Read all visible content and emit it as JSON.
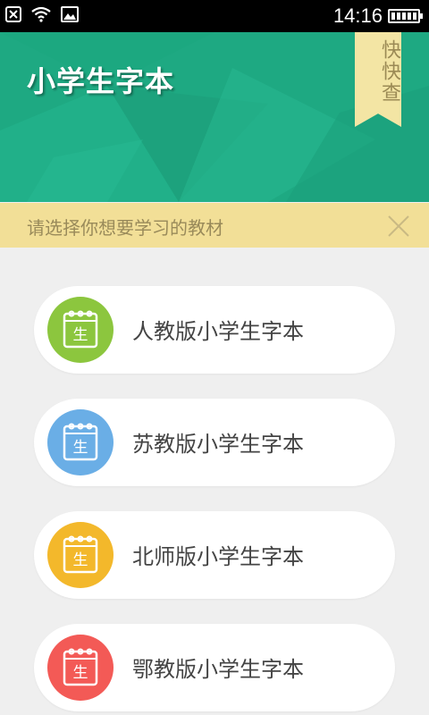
{
  "statusbar": {
    "time": "14:16",
    "icons": [
      "close-box-icon",
      "wifi-icon",
      "image-icon",
      "battery-icon"
    ]
  },
  "header": {
    "title": "小学生字本",
    "ribbon_label": "快快查"
  },
  "notice": {
    "text": "请选择你想要学习的教材",
    "close_icon": "close-icon"
  },
  "books": [
    {
      "label": "人教版小学生字本",
      "badge": "生",
      "color": "#8cc63e"
    },
    {
      "label": "苏教版小学生字本",
      "badge": "生",
      "color": "#6aaee6"
    },
    {
      "label": "北师版小学生字本",
      "badge": "生",
      "color": "#f3b82b"
    },
    {
      "label": "鄂教版小学生字本",
      "badge": "生",
      "color": "#f35a56"
    }
  ],
  "colors": {
    "header_green": "#1ea982",
    "notice_bg": "#f2df97",
    "page_bg": "#efefef"
  }
}
